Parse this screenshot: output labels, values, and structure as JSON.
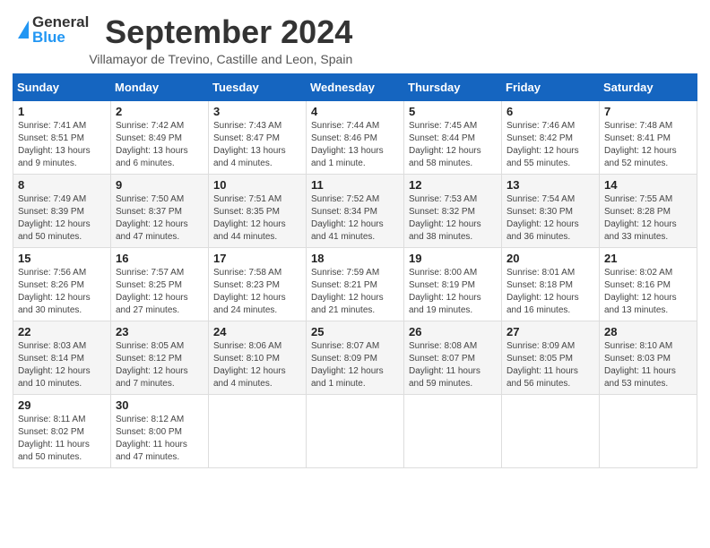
{
  "header": {
    "logo_general": "General",
    "logo_blue": "Blue",
    "month_title": "September 2024",
    "subtitle": "Villamayor de Trevino, Castille and Leon, Spain"
  },
  "calendar": {
    "days_of_week": [
      "Sunday",
      "Monday",
      "Tuesday",
      "Wednesday",
      "Thursday",
      "Friday",
      "Saturday"
    ],
    "weeks": [
      [
        {
          "day": "1",
          "info": "Sunrise: 7:41 AM\nSunset: 8:51 PM\nDaylight: 13 hours\nand 9 minutes."
        },
        {
          "day": "2",
          "info": "Sunrise: 7:42 AM\nSunset: 8:49 PM\nDaylight: 13 hours\nand 6 minutes."
        },
        {
          "day": "3",
          "info": "Sunrise: 7:43 AM\nSunset: 8:47 PM\nDaylight: 13 hours\nand 4 minutes."
        },
        {
          "day": "4",
          "info": "Sunrise: 7:44 AM\nSunset: 8:46 PM\nDaylight: 13 hours\nand 1 minute."
        },
        {
          "day": "5",
          "info": "Sunrise: 7:45 AM\nSunset: 8:44 PM\nDaylight: 12 hours\nand 58 minutes."
        },
        {
          "day": "6",
          "info": "Sunrise: 7:46 AM\nSunset: 8:42 PM\nDaylight: 12 hours\nand 55 minutes."
        },
        {
          "day": "7",
          "info": "Sunrise: 7:48 AM\nSunset: 8:41 PM\nDaylight: 12 hours\nand 52 minutes."
        }
      ],
      [
        {
          "day": "8",
          "info": "Sunrise: 7:49 AM\nSunset: 8:39 PM\nDaylight: 12 hours\nand 50 minutes."
        },
        {
          "day": "9",
          "info": "Sunrise: 7:50 AM\nSunset: 8:37 PM\nDaylight: 12 hours\nand 47 minutes."
        },
        {
          "day": "10",
          "info": "Sunrise: 7:51 AM\nSunset: 8:35 PM\nDaylight: 12 hours\nand 44 minutes."
        },
        {
          "day": "11",
          "info": "Sunrise: 7:52 AM\nSunset: 8:34 PM\nDaylight: 12 hours\nand 41 minutes."
        },
        {
          "day": "12",
          "info": "Sunrise: 7:53 AM\nSunset: 8:32 PM\nDaylight: 12 hours\nand 38 minutes."
        },
        {
          "day": "13",
          "info": "Sunrise: 7:54 AM\nSunset: 8:30 PM\nDaylight: 12 hours\nand 36 minutes."
        },
        {
          "day": "14",
          "info": "Sunrise: 7:55 AM\nSunset: 8:28 PM\nDaylight: 12 hours\nand 33 minutes."
        }
      ],
      [
        {
          "day": "15",
          "info": "Sunrise: 7:56 AM\nSunset: 8:26 PM\nDaylight: 12 hours\nand 30 minutes."
        },
        {
          "day": "16",
          "info": "Sunrise: 7:57 AM\nSunset: 8:25 PM\nDaylight: 12 hours\nand 27 minutes."
        },
        {
          "day": "17",
          "info": "Sunrise: 7:58 AM\nSunset: 8:23 PM\nDaylight: 12 hours\nand 24 minutes."
        },
        {
          "day": "18",
          "info": "Sunrise: 7:59 AM\nSunset: 8:21 PM\nDaylight: 12 hours\nand 21 minutes."
        },
        {
          "day": "19",
          "info": "Sunrise: 8:00 AM\nSunset: 8:19 PM\nDaylight: 12 hours\nand 19 minutes."
        },
        {
          "day": "20",
          "info": "Sunrise: 8:01 AM\nSunset: 8:18 PM\nDaylight: 12 hours\nand 16 minutes."
        },
        {
          "day": "21",
          "info": "Sunrise: 8:02 AM\nSunset: 8:16 PM\nDaylight: 12 hours\nand 13 minutes."
        }
      ],
      [
        {
          "day": "22",
          "info": "Sunrise: 8:03 AM\nSunset: 8:14 PM\nDaylight: 12 hours\nand 10 minutes."
        },
        {
          "day": "23",
          "info": "Sunrise: 8:05 AM\nSunset: 8:12 PM\nDaylight: 12 hours\nand 7 minutes."
        },
        {
          "day": "24",
          "info": "Sunrise: 8:06 AM\nSunset: 8:10 PM\nDaylight: 12 hours\nand 4 minutes."
        },
        {
          "day": "25",
          "info": "Sunrise: 8:07 AM\nSunset: 8:09 PM\nDaylight: 12 hours\nand 1 minute."
        },
        {
          "day": "26",
          "info": "Sunrise: 8:08 AM\nSunset: 8:07 PM\nDaylight: 11 hours\nand 59 minutes."
        },
        {
          "day": "27",
          "info": "Sunrise: 8:09 AM\nSunset: 8:05 PM\nDaylight: 11 hours\nand 56 minutes."
        },
        {
          "day": "28",
          "info": "Sunrise: 8:10 AM\nSunset: 8:03 PM\nDaylight: 11 hours\nand 53 minutes."
        }
      ],
      [
        {
          "day": "29",
          "info": "Sunrise: 8:11 AM\nSunset: 8:02 PM\nDaylight: 11 hours\nand 50 minutes."
        },
        {
          "day": "30",
          "info": "Sunrise: 8:12 AM\nSunset: 8:00 PM\nDaylight: 11 hours\nand 47 minutes."
        },
        {
          "day": "",
          "info": ""
        },
        {
          "day": "",
          "info": ""
        },
        {
          "day": "",
          "info": ""
        },
        {
          "day": "",
          "info": ""
        },
        {
          "day": "",
          "info": ""
        }
      ]
    ]
  }
}
